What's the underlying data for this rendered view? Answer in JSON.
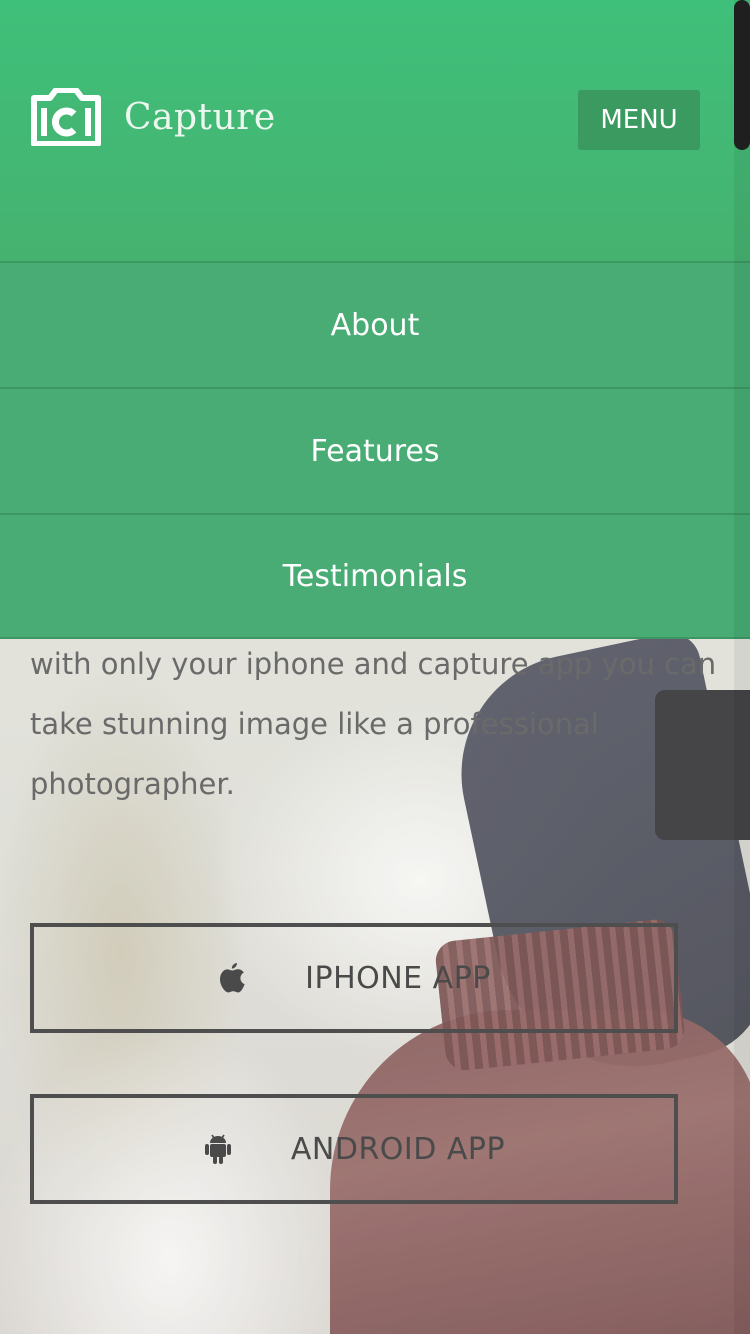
{
  "header": {
    "logo_text": "Capture",
    "menu_label": "MENU"
  },
  "nav": {
    "items": [
      {
        "label": "About"
      },
      {
        "label": "Features"
      },
      {
        "label": "Testimonials"
      }
    ]
  },
  "hero": {
    "text_line1": "with only your iphone and capture app you can",
    "text_line2": "take stunning image like a professional",
    "text_line3": "photographer.",
    "iphone_button": "IPHONE APP",
    "android_button": "ANDROID APP"
  },
  "colors": {
    "brand_green": "#3fc07a",
    "nav_green": "#48ac74",
    "menu_button": "#3a9a60",
    "button_border": "#4e4e4e"
  },
  "icons": {
    "logo": "camera-logo-icon",
    "iphone": "apple-icon",
    "android": "android-icon"
  }
}
